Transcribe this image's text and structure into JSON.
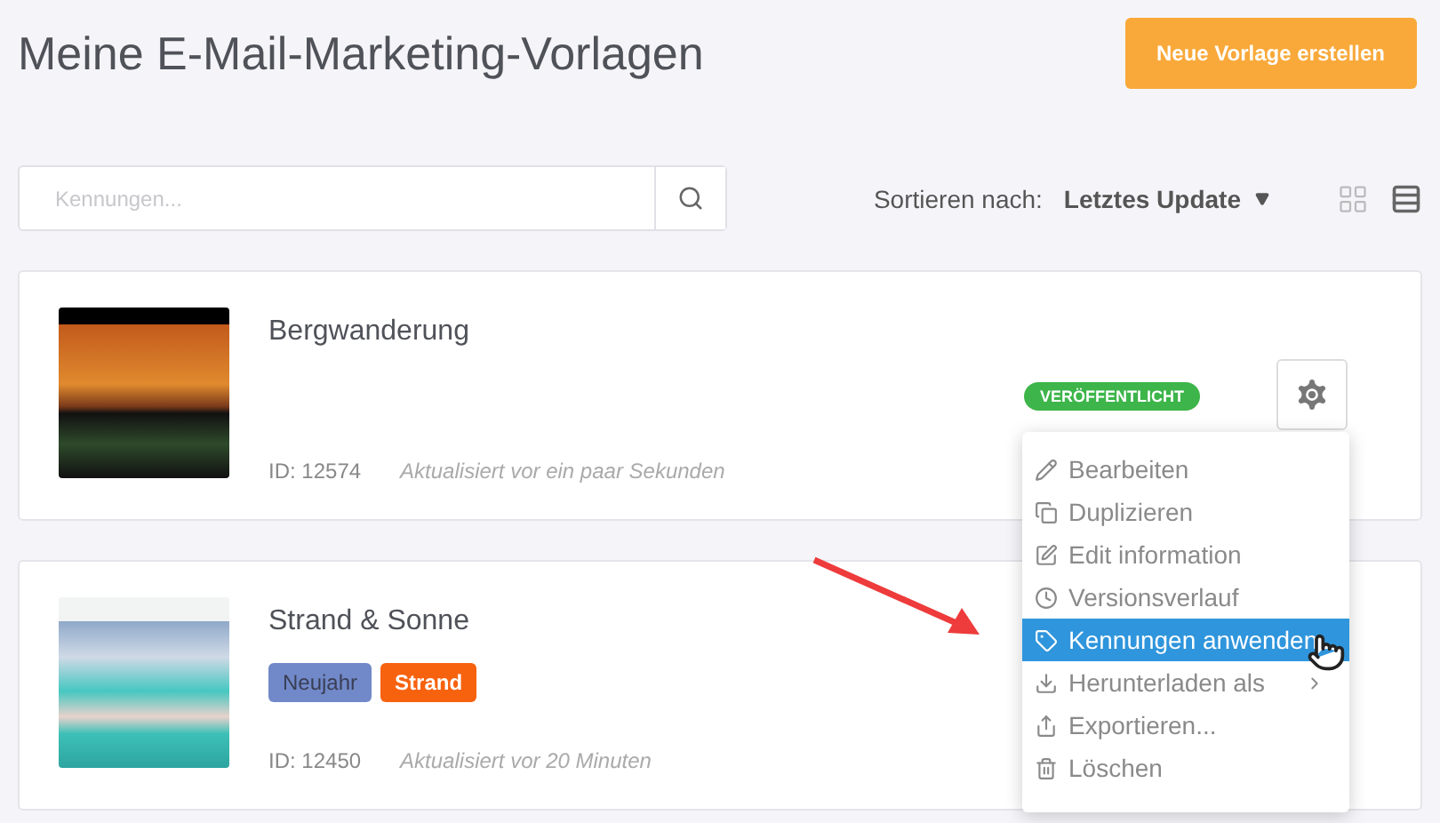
{
  "page_title": "Meine E-Mail-Marketing-Vorlagen",
  "new_button": "Neue Vorlage erstellen",
  "search": {
    "placeholder": "Kennungen..."
  },
  "sort": {
    "label": "Sortieren nach:",
    "value": "Letztes Update"
  },
  "view_toggle": [
    {
      "kind": "grid",
      "selected": false
    },
    {
      "kind": "list",
      "selected": true
    }
  ],
  "templates": [
    {
      "name": "Bergwanderung",
      "id_text": "ID: 12574",
      "updated": "Aktualisiert vor ein paar Sekunden",
      "status": "VERÖFFENTLICHT"
    },
    {
      "name": "Strand & Sonne",
      "id_text": "ID: 12450",
      "updated": "Aktualisiert vor 20 Minuten",
      "tags": [
        {
          "label": "Neujahr",
          "color": "#7189c9"
        },
        {
          "label": "Strand",
          "color": "#f7620f"
        }
      ]
    }
  ],
  "context_menu": {
    "items": [
      {
        "label": "Bearbeiten",
        "kind": "edit",
        "selected": false
      },
      {
        "label": "Duplizieren",
        "kind": "copy",
        "selected": false
      },
      {
        "label": "Edit information",
        "kind": "info",
        "selected": false
      },
      {
        "label": "Versionsverlauf",
        "kind": "history",
        "selected": false
      },
      {
        "label": "Kennungen anwenden",
        "kind": "tag",
        "selected": true
      },
      {
        "label": "Herunterladen als",
        "kind": "download",
        "selected": false,
        "submenu": true
      },
      {
        "label": "Exportieren...",
        "kind": "export",
        "selected": false
      },
      {
        "label": "Löschen",
        "kind": "delete",
        "selected": false
      }
    ]
  }
}
